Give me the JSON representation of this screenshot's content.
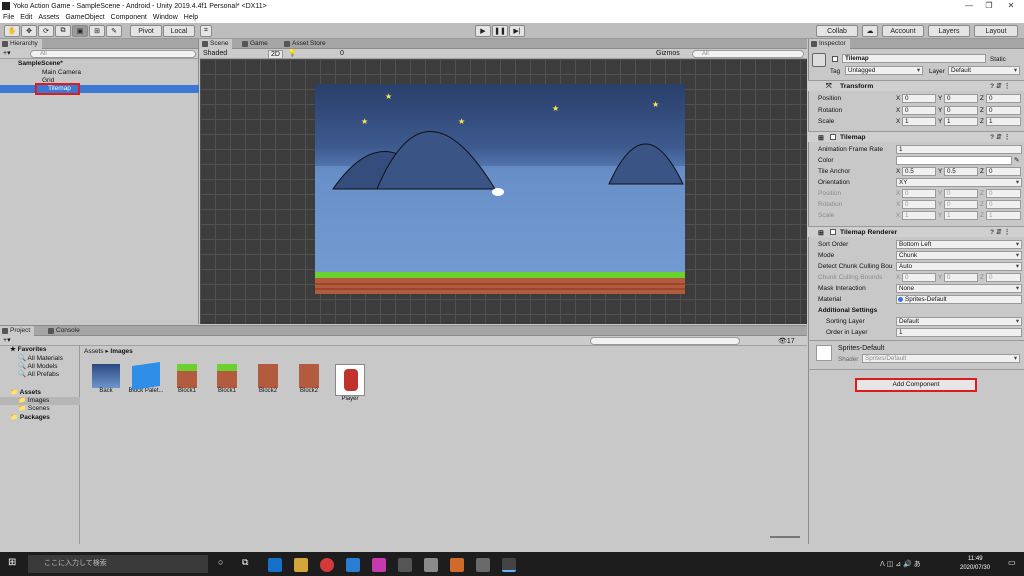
{
  "window": {
    "title": "Yoko Action Game - SampleScene - Android - Unity 2019.4.4f1 Personal* <DX11>"
  },
  "menu": [
    "File",
    "Edit",
    "Assets",
    "GameObject",
    "Component",
    "Window",
    "Help"
  ],
  "toolbar": {
    "pivot": "Pivot",
    "local": "Local",
    "collab": "Collab",
    "account": "Account",
    "layers": "Layers",
    "layout": "Layout"
  },
  "hierarchy": {
    "tab": "Hierarchy",
    "search_placeholder": "All",
    "items": [
      {
        "label": "SampleScene*"
      },
      {
        "label": "Main Camera"
      },
      {
        "label": "Grid"
      },
      {
        "label": "Tilemap"
      }
    ]
  },
  "scene": {
    "tabs": [
      "Scene",
      "Game",
      "Asset Store"
    ],
    "shading": "Shaded",
    "mode2d": "2D",
    "gizmos": "Gizmos",
    "search_placeholder": "All",
    "hidden_count": "0"
  },
  "project": {
    "tabs": [
      "Project",
      "Console"
    ],
    "favorites": {
      "label": "Favorites",
      "items": [
        "All Materials",
        "All Models",
        "All Prefabs"
      ]
    },
    "assets": {
      "label": "Assets",
      "items": [
        "Images",
        "Scenes"
      ]
    },
    "packages": "Packages",
    "breadcrumb": [
      "Assets",
      "Images"
    ],
    "count": "17",
    "files": [
      "Back",
      "Block Palet...",
      "Block1",
      "Block1",
      "Block2",
      "Block2",
      "Player"
    ]
  },
  "inspector": {
    "tab": "Inspector",
    "name": "Tilemap",
    "static": "Static",
    "tag_label": "Tag",
    "tag": "Untagged",
    "layer_label": "Layer",
    "layer": "Default",
    "transform": {
      "title": "Transform",
      "rows": [
        {
          "label": "Position",
          "x": "0",
          "y": "0",
          "z": "0"
        },
        {
          "label": "Rotation",
          "x": "0",
          "y": "0",
          "z": "0"
        },
        {
          "label": "Scale",
          "x": "1",
          "y": "1",
          "z": "1"
        }
      ]
    },
    "tilemap": {
      "title": "Tilemap",
      "frame_rate_label": "Animation Frame Rate",
      "frame_rate": "1",
      "color_label": "Color",
      "anchor_label": "Tile Anchor",
      "anchor": {
        "x": "0.5",
        "y": "0.5",
        "z": "0"
      },
      "orientation_label": "Orientation",
      "orientation": "XY",
      "dim_rows": [
        {
          "label": "Position",
          "x": "0",
          "y": "0",
          "z": "0"
        },
        {
          "label": "Rotation",
          "x": "0",
          "y": "0",
          "z": "0"
        },
        {
          "label": "Scale",
          "x": "1",
          "y": "1",
          "z": "1"
        }
      ]
    },
    "renderer": {
      "title": "Tilemap Renderer",
      "sort_order_label": "Sort Order",
      "sort_order": "Bottom Left",
      "mode_label": "Mode",
      "mode": "Chunk",
      "detect_label": "Detect Chunk Culling Bou",
      "detect": "Auto",
      "bounds_label": "Chunk Culling Bounds",
      "bounds": {
        "x": "0",
        "y": "0",
        "z": "0"
      },
      "mask_label": "Mask Interaction",
      "mask": "None",
      "material_label": "Material",
      "material": "Sprites-Default",
      "additional": "Additional Settings",
      "sorting_layer_label": "Sorting Layer",
      "sorting_layer": "Default",
      "order_label": "Order in Layer",
      "order": "1"
    },
    "material": {
      "name": "Sprites-Default",
      "shader_label": "Shader",
      "shader": "Sprites/Default"
    },
    "add_component": "Add Component"
  },
  "taskbar": {
    "search_placeholder": "ここに入力して検索",
    "time": "11:49",
    "date": "2020/07/30"
  }
}
